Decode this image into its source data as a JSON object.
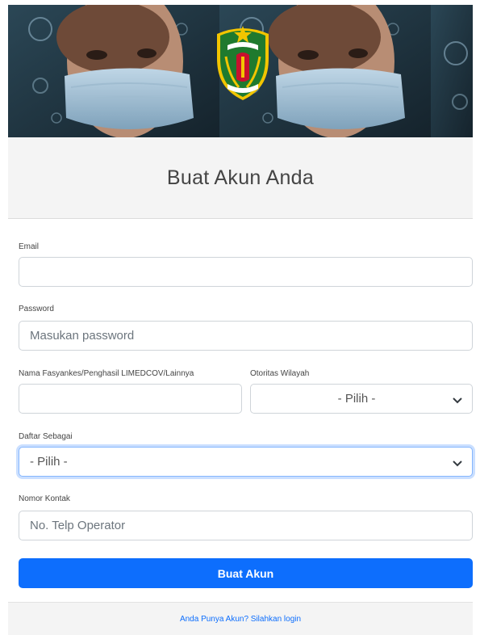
{
  "banner": {
    "logo_icon": "provincial-emblem-shield-icon"
  },
  "header": {
    "title": "Buat Akun Anda"
  },
  "form": {
    "email": {
      "label": "Email",
      "value": "",
      "placeholder": ""
    },
    "password": {
      "label": "Password",
      "value": "",
      "placeholder": "Masukan password"
    },
    "facility_name": {
      "label": "Nama Fasyankes/Penghasil LIMEDCOV/Lainnya",
      "value": "",
      "placeholder": ""
    },
    "region_authority": {
      "label": "Otoritas Wilayah",
      "selected": "- Pilih -"
    },
    "register_as": {
      "label": "Daftar Sebagai",
      "selected": "- Pilih -"
    },
    "contact": {
      "label": "Nomor Kontak",
      "value": "",
      "placeholder": "No. Telp Operator"
    }
  },
  "actions": {
    "submit_label": "Buat Akun"
  },
  "footer": {
    "login_link": "Anda Punya Akun? Silahkan login"
  },
  "colors": {
    "primary": "#0d6efd",
    "header_bg": "#f4f4f4",
    "logo_green": "#1f7a2e",
    "logo_red": "#c8102e",
    "logo_yellow": "#f2c500"
  }
}
